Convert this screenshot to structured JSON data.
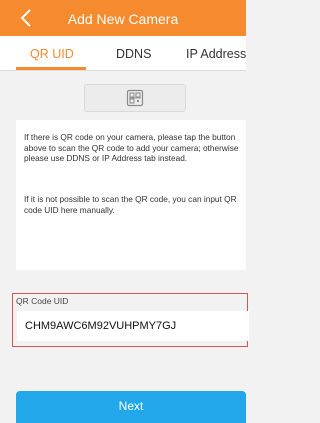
{
  "colors": {
    "accent": "#f58a2e",
    "primary_button": "#22a7ea",
    "highlight_border": "#d9534f"
  },
  "header": {
    "title": "Add New Camera",
    "back_icon": "chevron-left-icon"
  },
  "tabs": [
    {
      "label": "QR UID",
      "active": true
    },
    {
      "label": "DDNS",
      "active": false
    },
    {
      "label": "IP Address",
      "active": false
    }
  ],
  "scan": {
    "icon": "qr-scan-icon"
  },
  "info": {
    "paragraph1": "If there is QR code on your camera, please tap the button above to scan the QR code to add your camera; otherwise please use DDNS or IP Address tab instead.",
    "paragraph2": "If it is not possible to scan the QR code, you can input QR code UID here manually."
  },
  "uid": {
    "label": "QR Code UID",
    "value": "CHM9AWC6M92VUHPMY7GJ"
  },
  "actions": {
    "next_label": "Next"
  }
}
